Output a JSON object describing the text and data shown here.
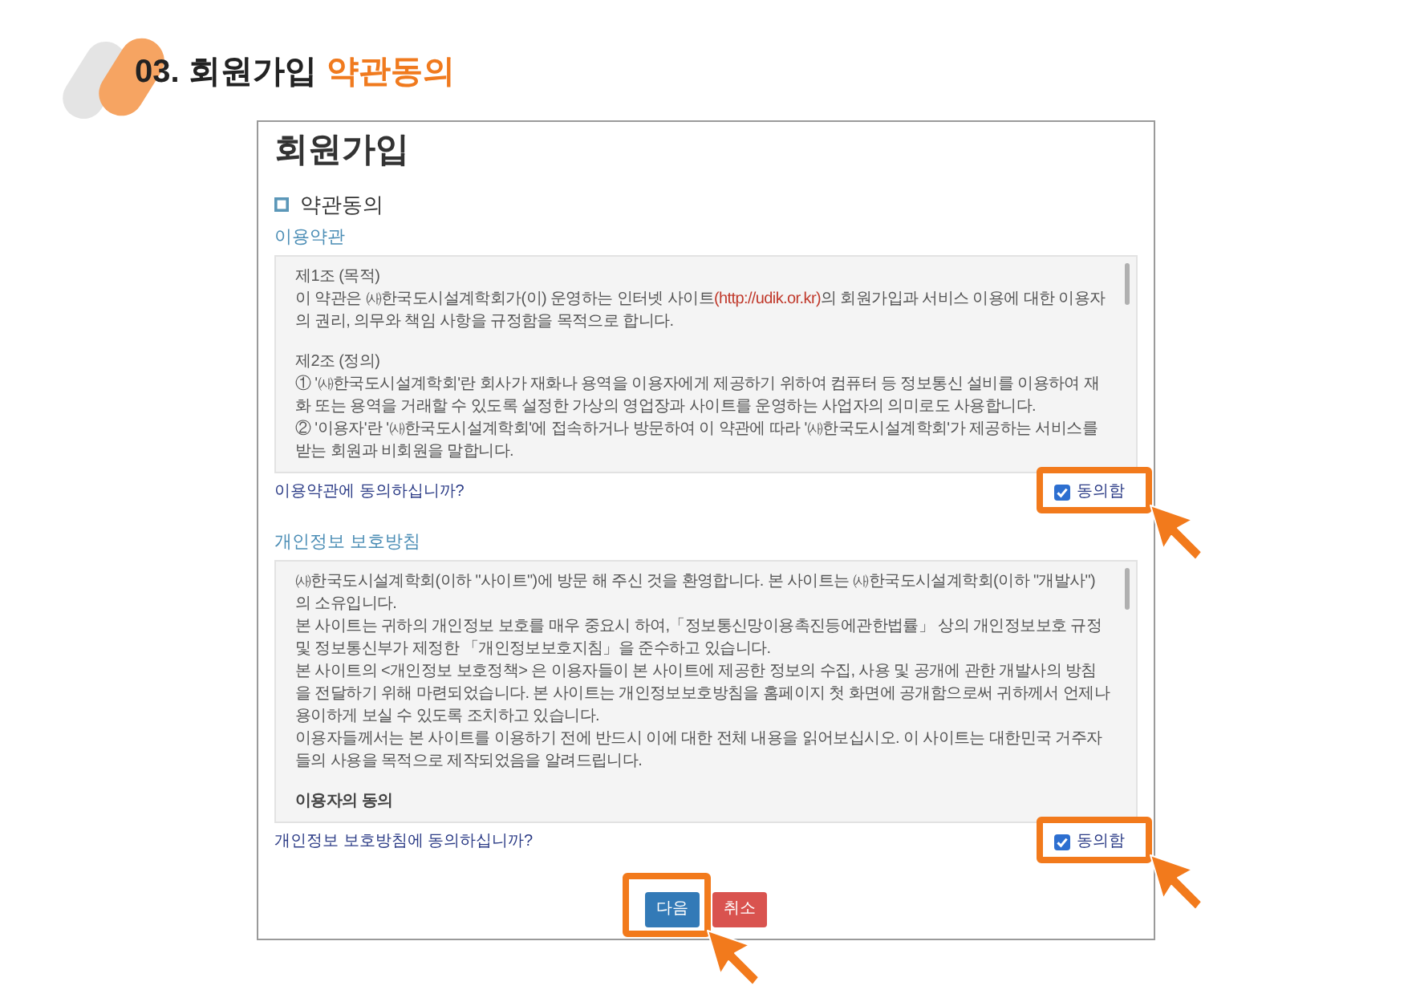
{
  "page_title": {
    "text": "03. 회원가입",
    "highlight": "약관동의"
  },
  "form": {
    "title": "회원가입",
    "section": "약관동의",
    "agreements": [
      {
        "heading": "이용약관",
        "blocks": [
          [
            {
              "kind": "text",
              "text": "제1조 (목적)"
            },
            {
              "kind": "link_text",
              "before": "이 약관은 ㈔한국도시설계학회가(이) 운영하는 인터넷 사이트",
              "link": "(http://udik.or.kr)",
              "after": "의 회원가입과 서비스 이용에 대한 이용자의 권리, 의무와 책임 사항을 규정함을 목적으로 합니다."
            }
          ],
          [
            {
              "kind": "text",
              "text": "제2조 (정의)"
            },
            {
              "kind": "text",
              "text": "① '㈔한국도시설계학회'란 회사가 재화나 용역을 이용자에게 제공하기 위하여 컴퓨터 등 정보통신 설비를 이용하여 재화 또는 용역을 거래할 수 있도록 설정한 가상의 영업장과 사이트를 운영하는 사업자의 의미로도 사용합니다."
            },
            {
              "kind": "text",
              "text": "② '이용자'란 '㈔한국도시설계학회'에 접속하거나 방문하여 이 약관에 따라 '㈔한국도시설계학회'가 제공하는 서비스를 받는 회원과 비회원을 말합니다."
            }
          ]
        ],
        "question": "이용약관에 동의하십니까?",
        "checkbox": {
          "label": "동의함",
          "checked": true,
          "highlighted": true
        }
      },
      {
        "heading": "개인정보 보호방침",
        "blocks": [
          [
            {
              "kind": "text",
              "text": "㈔한국도시설계학회(이하 \"사이트\")에 방문 해 주신 것을 환영합니다. 본 사이트는 ㈔한국도시설계학회(이하 \"개발사\")의 소유입니다."
            },
            {
              "kind": "text",
              "text": "본 사이트는 귀하의 개인정보 보호를 매우 중요시 하여,「정보통신망이용촉진등에관한법률」 상의 개인정보보호 규정 및 정보통신부가 제정한 「개인정보보호지침」을 준수하고 있습니다."
            },
            {
              "kind": "text",
              "text": "본 사이트의 <개인정보 보호정책> 은 이용자들이 본 사이트에 제공한 정보의 수집, 사용 및 공개에 관한 개발사의 방침을 전달하기 위해 마련되었습니다. 본 사이트는 개인정보보호방침을 홈페이지 첫 화면에 공개함으로써 귀하께서 언제나 용이하게 보실 수 있도록 조치하고 있습니다."
            },
            {
              "kind": "text",
              "text": "이용자들께서는 본 사이트를 이용하기 전에 반드시 이에 대한 전체 내용을 읽어보십시오. 이 사이트는 대한민국 거주자들의 사용을 목적으로 제작되었음을 알려드립니다."
            }
          ],
          [
            {
              "kind": "bold",
              "text": "이용자의 동의"
            }
          ]
        ],
        "question": "개인정보 보호방침에 동의하십니까?",
        "checkbox": {
          "label": "동의함",
          "checked": true,
          "highlighted": true
        }
      }
    ],
    "buttons": [
      {
        "label": "다음",
        "kind": "primary",
        "highlighted": true
      },
      {
        "label": "취소",
        "kind": "danger",
        "highlighted": false
      }
    ]
  }
}
